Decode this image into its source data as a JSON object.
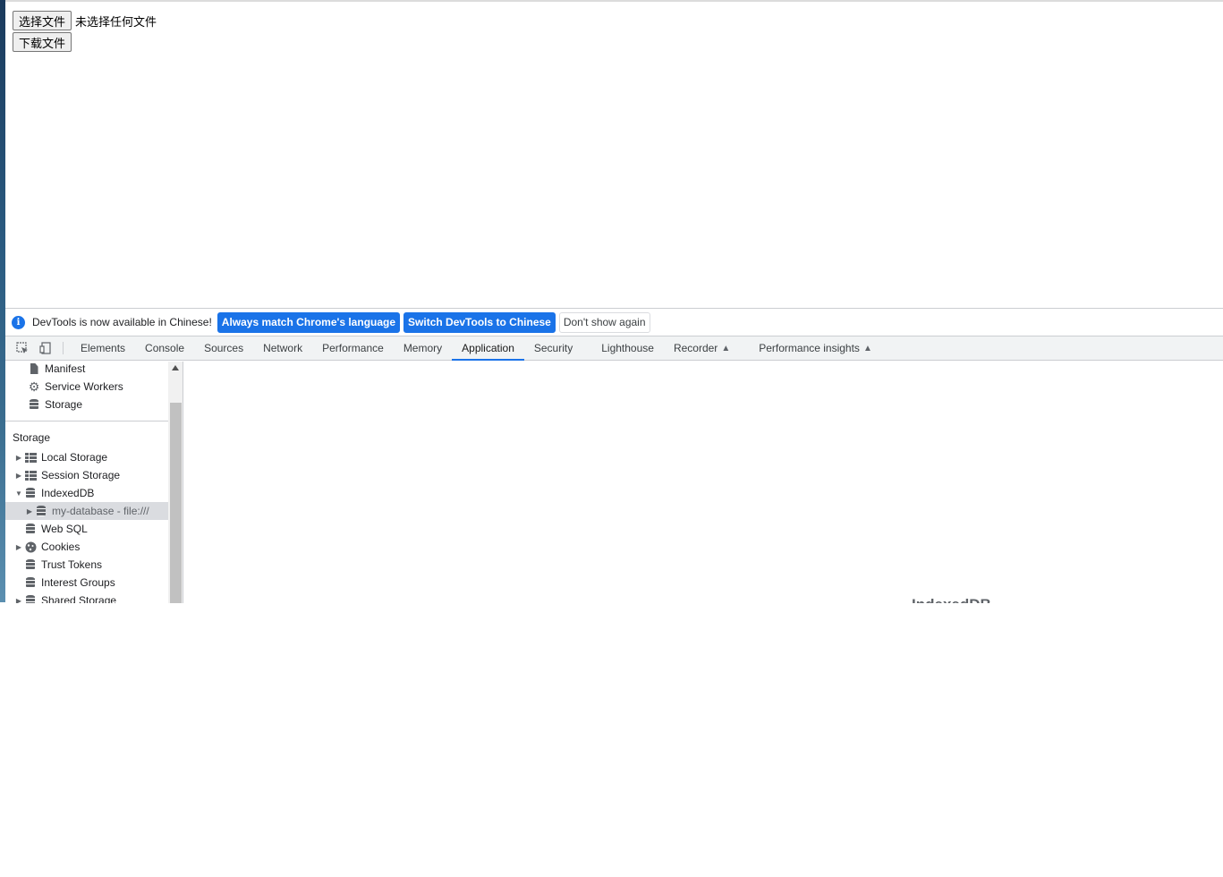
{
  "page": {
    "choose_file_label": "选择文件",
    "no_file_text": "未选择任何文件",
    "download_label": "下载文件"
  },
  "infobar": {
    "message": "DevTools is now available in Chinese!",
    "always_match": "Always match Chrome's language",
    "switch_chinese": "Switch DevTools to Chinese",
    "dont_show": "Don't show again"
  },
  "tabs": [
    {
      "label": "Elements"
    },
    {
      "label": "Console"
    },
    {
      "label": "Sources"
    },
    {
      "label": "Network"
    },
    {
      "label": "Performance"
    },
    {
      "label": "Memory"
    },
    {
      "label": "Application",
      "active": true
    },
    {
      "label": "Security"
    },
    {
      "label": "Lighthouse"
    },
    {
      "label": "Recorder"
    },
    {
      "label": "Performance insights"
    }
  ],
  "sidebar": {
    "app_items": [
      {
        "label": "Manifest",
        "icon": "document-icon"
      },
      {
        "label": "Service Workers",
        "icon": "gear-icon"
      },
      {
        "label": "Storage",
        "icon": "database-icon"
      }
    ],
    "storage_header": "Storage",
    "storage_items": [
      {
        "label": "Local Storage",
        "icon": "table-icon",
        "expandable": true,
        "expanded": false
      },
      {
        "label": "Session Storage",
        "icon": "table-icon",
        "expandable": true,
        "expanded": false
      },
      {
        "label": "IndexedDB",
        "icon": "database-icon",
        "expandable": true,
        "expanded": true
      },
      {
        "label": "my-database - file:///",
        "icon": "database-icon",
        "expandable": true,
        "expanded": false,
        "selected": true,
        "child": true
      },
      {
        "label": "Web SQL",
        "icon": "database-icon"
      },
      {
        "label": "Cookies",
        "icon": "cookie-icon",
        "expandable": true,
        "expanded": false
      },
      {
        "label": "Trust Tokens",
        "icon": "database-icon"
      },
      {
        "label": "Interest Groups",
        "icon": "database-icon"
      },
      {
        "label": "Shared Storage",
        "icon": "database-icon",
        "expandable": true,
        "expanded": false
      }
    ]
  },
  "content": {
    "title": "IndexedDB"
  }
}
